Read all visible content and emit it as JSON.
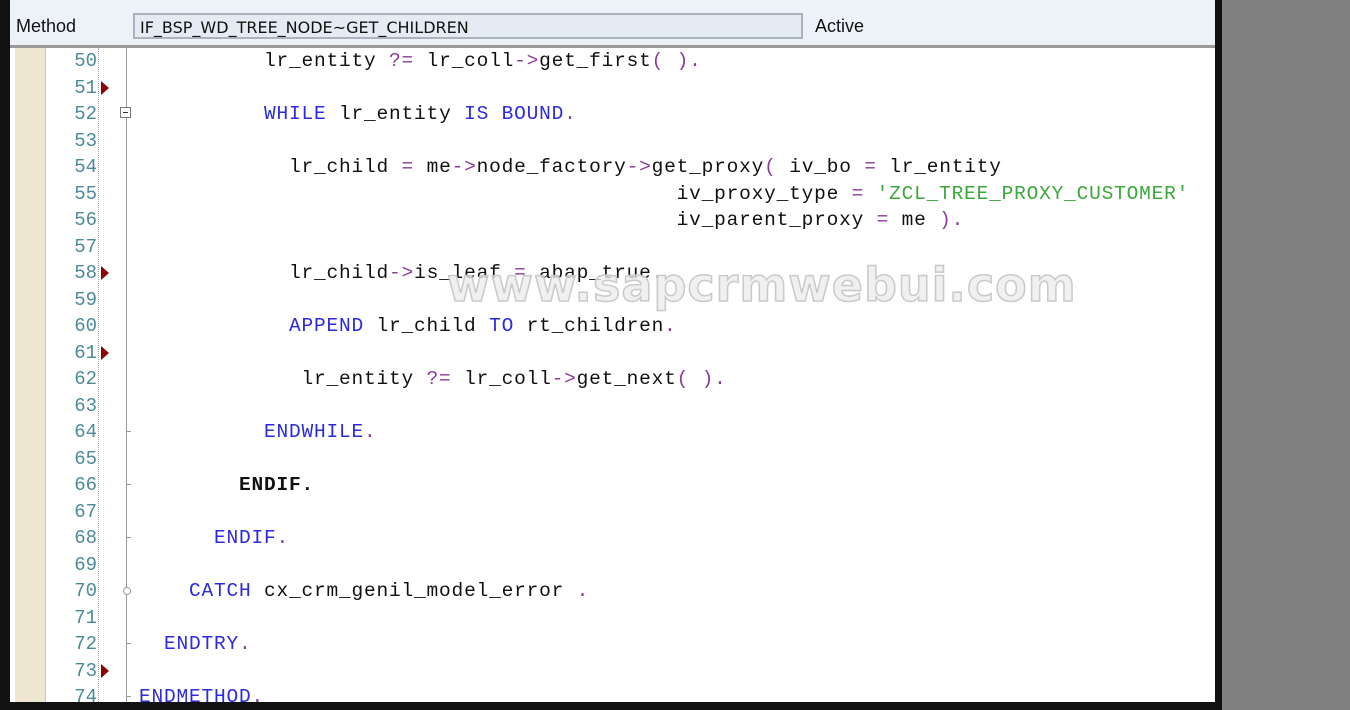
{
  "header": {
    "method_label": "Method",
    "method_value": "IF_BSP_WD_TREE_NODE~GET_CHILDREN",
    "status": "Active"
  },
  "watermark": "www.sapcrmwebui.com",
  "colors": {
    "keyword": "#2b2bdd",
    "operator": "#8a3a9a",
    "string": "#3aa83a",
    "breakpoint": "#8b0000"
  },
  "lines": [
    {
      "n": "50",
      "tokens": [
        [
          "          lr_entity ",
          ""
        ],
        [
          "?=",
          "op"
        ],
        [
          " lr_coll",
          ""
        ],
        [
          "->",
          "op"
        ],
        [
          "get_first",
          ""
        ],
        [
          "( ).",
          "op"
        ]
      ]
    },
    {
      "n": "51",
      "bp": true,
      "tokens": []
    },
    {
      "n": "52",
      "fold": "open",
      "tokens": [
        [
          "          ",
          ""
        ],
        [
          "WHILE",
          "kw"
        ],
        [
          " lr_entity ",
          ""
        ],
        [
          "IS BOUND",
          "kw"
        ],
        [
          ".",
          "op"
        ]
      ]
    },
    {
      "n": "53",
      "tokens": []
    },
    {
      "n": "54",
      "tokens": [
        [
          "            lr_child ",
          ""
        ],
        [
          "=",
          "op"
        ],
        [
          " me",
          ""
        ],
        [
          "->",
          "op"
        ],
        [
          "node_factory",
          ""
        ],
        [
          "->",
          "op"
        ],
        [
          "get_proxy",
          ""
        ],
        [
          "(",
          "op"
        ],
        [
          " iv_bo ",
          ""
        ],
        [
          "=",
          "op"
        ],
        [
          " lr_entity",
          ""
        ]
      ]
    },
    {
      "n": "55",
      "tokens": [
        [
          "                                           iv_proxy_type ",
          ""
        ],
        [
          "=",
          "op"
        ],
        [
          " ",
          ""
        ],
        [
          "'ZCL_TREE_PROXY_CUSTOMER'",
          "str"
        ]
      ]
    },
    {
      "n": "56",
      "tokens": [
        [
          "                                           iv_parent_proxy ",
          ""
        ],
        [
          "=",
          "op"
        ],
        [
          " me ",
          ""
        ],
        [
          ").",
          "op"
        ]
      ]
    },
    {
      "n": "57",
      "tokens": []
    },
    {
      "n": "58",
      "bp": true,
      "tokens": [
        [
          "            lr_child",
          ""
        ],
        [
          "->",
          "op"
        ],
        [
          "is_leaf ",
          ""
        ],
        [
          "=",
          "op"
        ],
        [
          " abap_true",
          ""
        ],
        [
          ".",
          "op"
        ]
      ]
    },
    {
      "n": "59",
      "tokens": []
    },
    {
      "n": "60",
      "tokens": [
        [
          "            ",
          ""
        ],
        [
          "APPEND",
          "kw"
        ],
        [
          " lr_child ",
          ""
        ],
        [
          "TO",
          "kw"
        ],
        [
          " rt_children",
          ""
        ],
        [
          ".",
          "op"
        ]
      ]
    },
    {
      "n": "61",
      "bp": true,
      "tokens": []
    },
    {
      "n": "62",
      "tokens": [
        [
          "             lr_entity ",
          ""
        ],
        [
          "?=",
          "op"
        ],
        [
          " lr_coll",
          ""
        ],
        [
          "->",
          "op"
        ],
        [
          "get_next",
          ""
        ],
        [
          "( ).",
          "op"
        ]
      ]
    },
    {
      "n": "63",
      "tokens": []
    },
    {
      "n": "64",
      "fold": "end",
      "tokens": [
        [
          "          ",
          ""
        ],
        [
          "ENDWHILE",
          "kw"
        ],
        [
          ".",
          "op"
        ]
      ]
    },
    {
      "n": "65",
      "tokens": []
    },
    {
      "n": "66",
      "fold": "end",
      "tokens": [
        [
          "        ",
          ""
        ],
        [
          "ENDIF",
          "kwb"
        ],
        [
          ".",
          "kwb"
        ]
      ]
    },
    {
      "n": "67",
      "tokens": []
    },
    {
      "n": "68",
      "fold": "end",
      "tokens": [
        [
          "      ",
          ""
        ],
        [
          "ENDIF",
          "kw"
        ],
        [
          ".",
          "op"
        ]
      ]
    },
    {
      "n": "69",
      "tokens": []
    },
    {
      "n": "70",
      "fold": "mid",
      "tokens": [
        [
          "    ",
          ""
        ],
        [
          "CATCH",
          "kw"
        ],
        [
          " cx_crm_genil_model_error ",
          ""
        ],
        [
          ".",
          "op"
        ]
      ]
    },
    {
      "n": "71",
      "tokens": []
    },
    {
      "n": "72",
      "fold": "end",
      "tokens": [
        [
          "  ",
          ""
        ],
        [
          "ENDTRY",
          "kw"
        ],
        [
          ".",
          "op"
        ]
      ]
    },
    {
      "n": "73",
      "bp": true,
      "tokens": []
    },
    {
      "n": "74",
      "fold": "end",
      "tokens": [
        [
          "ENDMETHOD",
          "kw"
        ],
        [
          ".",
          "op"
        ]
      ]
    }
  ]
}
